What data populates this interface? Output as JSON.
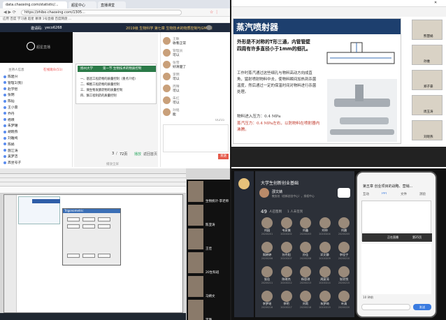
{
  "tl": {
    "tabs": [
      "data.chaoxing.com/statistic/...",
      "超星中心",
      "直播课堂"
    ],
    "url": "https://zhibo.chaoxing.com/1305...",
    "bookmarks": "应用  百度  学习通  超星  慕课  1号直播  百度网盘  ...",
    "header_title": "2019级 生物科学 第七章 生物技术的物质控制与GMP课",
    "invite_code_label": "邀请码:",
    "invite_code": "yeco6268",
    "video_logo": "超星直播",
    "sidebar_title": "主持人信息",
    "sidebar_tag": "在线观众(51)",
    "members": [
      "陈建兴",
      "管理1(我)",
      "赵学智",
      "张明",
      "陈灿",
      "王小雷",
      "乔丹",
      "杨瑛",
      "朱梦珺",
      "胡晓燕",
      "刘雅纯",
      "陈娟",
      "施江涛",
      "吴梦洁",
      "高坐号子"
    ],
    "slide": {
      "chapter": "第一节 生物技术的物质控制",
      "logo": "扬州大学",
      "items": [
        "一、基因工程药物的质量控制（重点介绍）",
        "二、细胞工程药物的质量控制",
        "三、微生物发酵药物的质量控制",
        "四、酶工程制药的质量控制"
      ],
      "page": "3",
      "total": "72页",
      "mode": "播放",
      "back": "返回首页"
    },
    "chat": [
      {
        "name": "王敏",
        "msg": "收看正常"
      },
      {
        "name": "管理员",
        "msg": "可以"
      },
      {
        "name": "张雪",
        "msg": "好清楚了"
      },
      {
        "name": "李明",
        "msg": "可以"
      },
      {
        "name": "周晴",
        "msg": "可以"
      },
      {
        "name": "朱红",
        "msg": "可以"
      },
      {
        "name": "孙铭",
        "msg": "能"
      }
    ],
    "chat_count": "0/255",
    "send": "发送",
    "footer": "播放全屏"
  },
  "tr": {
    "title": "蒸汽喷射器",
    "line1": "外形是不对称的T形三通，内管管壁四周有许多直径小于1mm的细孔。",
    "body": "工作时蒸汽通过这些细孔与物料高动方向成直角，猛射喷射物料中去，使物料瞬间加热到杀菌温度，然后通过一定的保温时间对物料进行杀菌处理。",
    "pressure1": "物料进入压力：0.4 MPa",
    "pressure2": "蒸汽压力：0.4 MPa左右，以防物料在喷射器内沸腾。",
    "attendees": [
      "熊慧娟",
      "孙维",
      "郑子豪",
      "周玉涛",
      "刘晓燕"
    ]
  },
  "bl": {
    "participants": [
      "生物统计-李老师",
      "陈亚涛",
      "王佳",
      "20生科班",
      "马婧文",
      "李璐"
    ],
    "dialog_title": "Trigonometric"
  },
  "br": {
    "header": "大学生创新创业基础",
    "teacher": "邵文婧",
    "teacher_sub": "教务处（创新创业中心），授权中心",
    "attend_count": "49",
    "attend_label": "人已签到",
    "late": "1 人未签到",
    "students": [
      {
        "name": "刘园",
        "id": "20200201"
      },
      {
        "name": "韦家美",
        "id": "20200202"
      },
      {
        "name": "刘鑫",
        "id": "20200203"
      },
      {
        "name": "刘帅",
        "id": "20200204"
      },
      {
        "name": "刘晨",
        "id": "20200205"
      },
      {
        "name": "周婷婷",
        "id": "20200206"
      },
      {
        "name": "孙丹阳",
        "id": "20200207"
      },
      {
        "name": "孙佳",
        "id": "20200208"
      },
      {
        "name": "邓文静",
        "id": "20200209"
      },
      {
        "name": "李佳宁",
        "id": "20200210"
      },
      {
        "name": "张佳",
        "id": "20200211"
      },
      {
        "name": "陈晓杰",
        "id": "20200212"
      },
      {
        "name": "杨思琪",
        "id": "20200213"
      },
      {
        "name": "周宸涛",
        "id": "20200214"
      },
      {
        "name": "张欣悦",
        "id": "20200215"
      },
      {
        "name": "李梦瑶",
        "id": "20200216"
      },
      {
        "name": "李明",
        "id": "20200217"
      },
      {
        "name": "刘莉",
        "id": "20200218"
      },
      {
        "name": "朱梦琦",
        "id": "20200219"
      },
      {
        "name": "叶清",
        "id": "20200220"
      }
    ],
    "phone_title": "第五章 创业项目的战略、营销...",
    "phone_tabs": [
      "互动",
      "PPT",
      "文件",
      "测验"
    ],
    "phone_live": "正在直播",
    "phone_sub": "10 钟前",
    "phone_send": "发送",
    "phone_page": "第25页"
  }
}
